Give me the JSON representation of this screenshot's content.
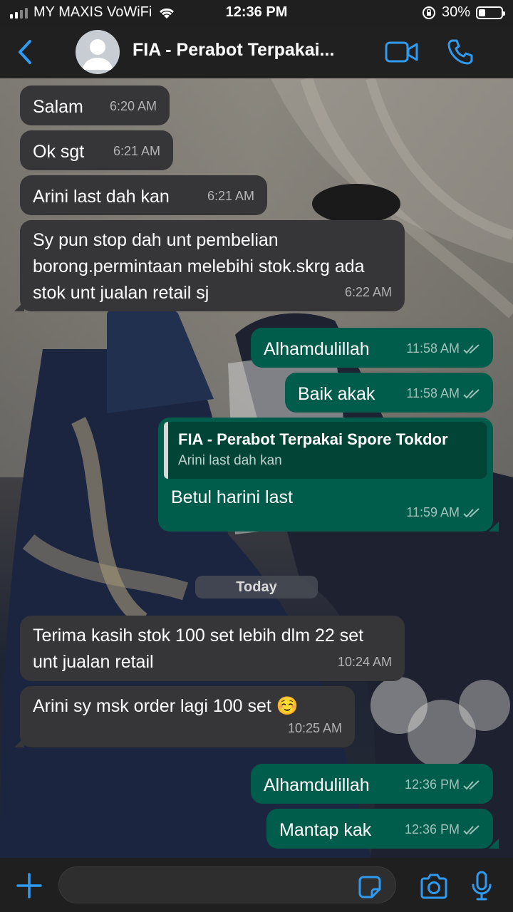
{
  "status_bar": {
    "carrier": "MY MAXIS VoWiFi",
    "time": "12:36 PM",
    "battery_percent": "30%",
    "battery_level": 0.3,
    "icons": [
      "signal-icon",
      "wifi-icon",
      "rotation-lock-icon",
      "battery-icon"
    ]
  },
  "header": {
    "title": "FIA - Perabot Terpakai...",
    "icons": [
      "back-icon",
      "avatar-placeholder-icon",
      "video-call-icon",
      "phone-icon"
    ]
  },
  "messages": [
    {
      "direction": "in",
      "text": "Salam",
      "time": "6:20 AM"
    },
    {
      "direction": "in",
      "text": "Ok sgt",
      "time": "6:21 AM"
    },
    {
      "direction": "in",
      "text": "Arini last dah kan",
      "time": "6:21 AM"
    },
    {
      "direction": "in",
      "text": "Sy pun stop dah unt pembelian borong.permintaan melebihi stok.skrg ada stok unt jualan retail sj",
      "time": "6:22 AM"
    },
    {
      "direction": "out",
      "text": "Alhamdulillah",
      "time": "11:58 AM",
      "status": "read"
    },
    {
      "direction": "out",
      "text": "Baik akak",
      "time": "11:58 AM",
      "status": "read"
    },
    {
      "direction": "out",
      "text": "Betul harini last",
      "time": "11:59 AM",
      "status": "read",
      "quote": {
        "name": "FIA - Perabot Terpakai Spore Tokdor",
        "text": "Arini last dah kan"
      }
    },
    {
      "direction": "in",
      "text": "Terima kasih stok 100 set lebih dlm 22 set unt jualan retail",
      "time": "10:24 AM"
    },
    {
      "direction": "in",
      "text": "Arini sy msk order lagi 100 set ☺️",
      "time": "10:25 AM"
    },
    {
      "direction": "out",
      "text": "Alhamdulillah",
      "time": "12:36 PM",
      "status": "read"
    },
    {
      "direction": "out",
      "text": "Mantap kak",
      "time": "12:36 PM",
      "status": "read"
    }
  ],
  "day_separator": "Today",
  "input_bar": {
    "placeholder": "",
    "icons": [
      "plus-icon",
      "sticker-icon",
      "camera-icon",
      "microphone-icon"
    ]
  },
  "colors": {
    "accent": "#2f9bf0",
    "incoming_bubble": "#363638",
    "outgoing_bubble": "#005c4b",
    "quote_background": "#024537"
  }
}
